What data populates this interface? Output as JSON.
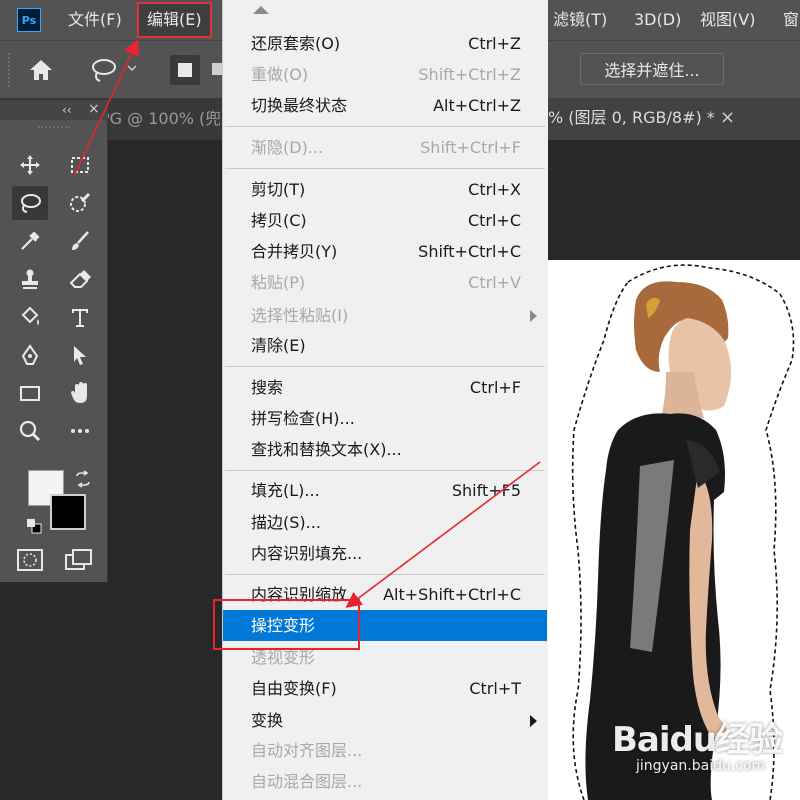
{
  "app": {
    "logo": "Ps"
  },
  "menubar": {
    "items": [
      {
        "label": "文件(F)"
      },
      {
        "label": "编辑(E)"
      },
      {
        "label": "滤镜(T)"
      },
      {
        "label": "3D(D)"
      },
      {
        "label": "视图(V)"
      },
      {
        "label": "窗"
      }
    ]
  },
  "options_bar": {
    "home_icon": "home-icon",
    "lasso_icon": "lasso-icon",
    "select_and_mask_label": "选择并遮住..."
  },
  "document_tabs": {
    "left_tab_label": "PG @ 100% (兜",
    "right_tab_label": "% (图层 0, RGB/8#) *",
    "close_glyph": "×"
  },
  "toolbar": {
    "collapse_glyph": "‹‹",
    "close_glyph": "×",
    "tools": [
      {
        "icon": "move-icon"
      },
      {
        "icon": "marquee-icon"
      },
      {
        "icon": "lasso-icon",
        "active": true
      },
      {
        "icon": "quick-select-icon"
      },
      {
        "icon": "eyedropper-icon"
      },
      {
        "icon": "brush-icon"
      },
      {
        "icon": "stamp-icon"
      },
      {
        "icon": "eraser-icon"
      },
      {
        "icon": "paint-bucket-icon"
      },
      {
        "icon": "type-icon"
      },
      {
        "icon": "pen-icon"
      },
      {
        "icon": "path-select-icon"
      },
      {
        "icon": "rectangle-icon"
      },
      {
        "icon": "hand-icon"
      },
      {
        "icon": "zoom-icon"
      },
      {
        "icon": "more-tools-icon"
      }
    ],
    "foreground_color": "#f4f4f6",
    "background_color": "#000000"
  },
  "edit_menu": {
    "items": [
      {
        "label": "还原套索(O)",
        "shortcut": "Ctrl+Z",
        "enabled": true
      },
      {
        "label": "重做(O)",
        "shortcut": "Shift+Ctrl+Z",
        "enabled": false
      },
      {
        "label": "切换最终状态",
        "shortcut": "Alt+Ctrl+Z",
        "enabled": true
      },
      {
        "label": "渐隐(D)...",
        "shortcut": "Shift+Ctrl+F",
        "enabled": false
      },
      {
        "label": "剪切(T)",
        "shortcut": "Ctrl+X",
        "enabled": true
      },
      {
        "label": "拷贝(C)",
        "shortcut": "Ctrl+C",
        "enabled": true
      },
      {
        "label": "合并拷贝(Y)",
        "shortcut": "Shift+Ctrl+C",
        "enabled": true
      },
      {
        "label": "粘贴(P)",
        "shortcut": "Ctrl+V",
        "enabled": false
      },
      {
        "label": "选择性粘贴(I)",
        "shortcut": "",
        "enabled": false,
        "submenu": true
      },
      {
        "label": "清除(E)",
        "shortcut": "",
        "enabled": true
      },
      {
        "label": "搜索",
        "shortcut": "Ctrl+F",
        "enabled": true
      },
      {
        "label": "拼写检查(H)...",
        "shortcut": "",
        "enabled": true
      },
      {
        "label": "查找和替换文本(X)...",
        "shortcut": "",
        "enabled": true
      },
      {
        "label": "填充(L)...",
        "shortcut": "Shift+F5",
        "enabled": true
      },
      {
        "label": "描边(S)...",
        "shortcut": "",
        "enabled": true
      },
      {
        "label": "内容识别填充...",
        "shortcut": "",
        "enabled": true
      },
      {
        "label": "内容识别缩放",
        "shortcut": "Alt+Shift+Ctrl+C",
        "enabled": true
      },
      {
        "label": "操控变形",
        "shortcut": "",
        "enabled": true,
        "highlighted": true
      },
      {
        "label": "透视变形",
        "shortcut": "",
        "enabled": false
      },
      {
        "label": "自由变换(F)",
        "shortcut": "Ctrl+T",
        "enabled": true
      },
      {
        "label": "变换",
        "shortcut": "",
        "enabled": true,
        "submenu": true
      },
      {
        "label": "自动对齐图层...",
        "shortcut": "",
        "enabled": false
      },
      {
        "label": "自动混合图层...",
        "shortcut": "",
        "enabled": false
      }
    ]
  },
  "watermark": {
    "brand": "Baidu经验",
    "url": "jingyan.baidu.com"
  },
  "colors": {
    "menu_highlight": "#0078d7",
    "annotation_red": "#e8232f",
    "ui_panel": "#535353",
    "workspace": "#282828"
  }
}
